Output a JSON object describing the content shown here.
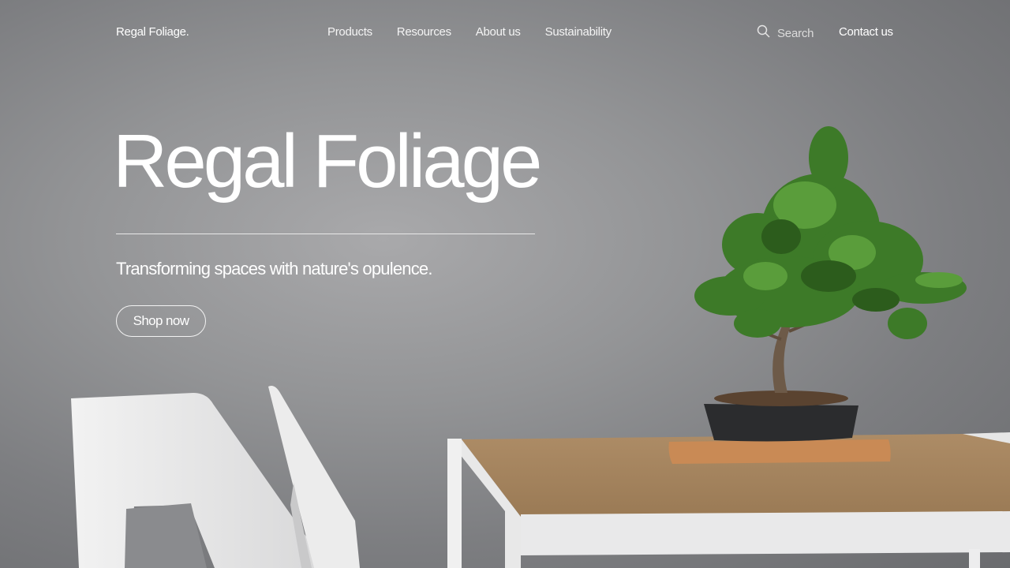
{
  "nav": {
    "brand": "Regal Foliage.",
    "links": [
      {
        "label": "Products"
      },
      {
        "label": "Resources"
      },
      {
        "label": "About us"
      },
      {
        "label": "Sustainability"
      }
    ],
    "search_label": "Search",
    "contact_label": "Contact us"
  },
  "hero": {
    "title": "Regal Foliage",
    "subtitle": "Transforming spaces with nature's opulence.",
    "cta_label": "Shop now"
  },
  "icons": {
    "search": "search-icon"
  },
  "colors": {
    "background": "#939496",
    "text": "#ffffff",
    "table_top": "#a58560",
    "foliage": "#3f7a2a"
  }
}
